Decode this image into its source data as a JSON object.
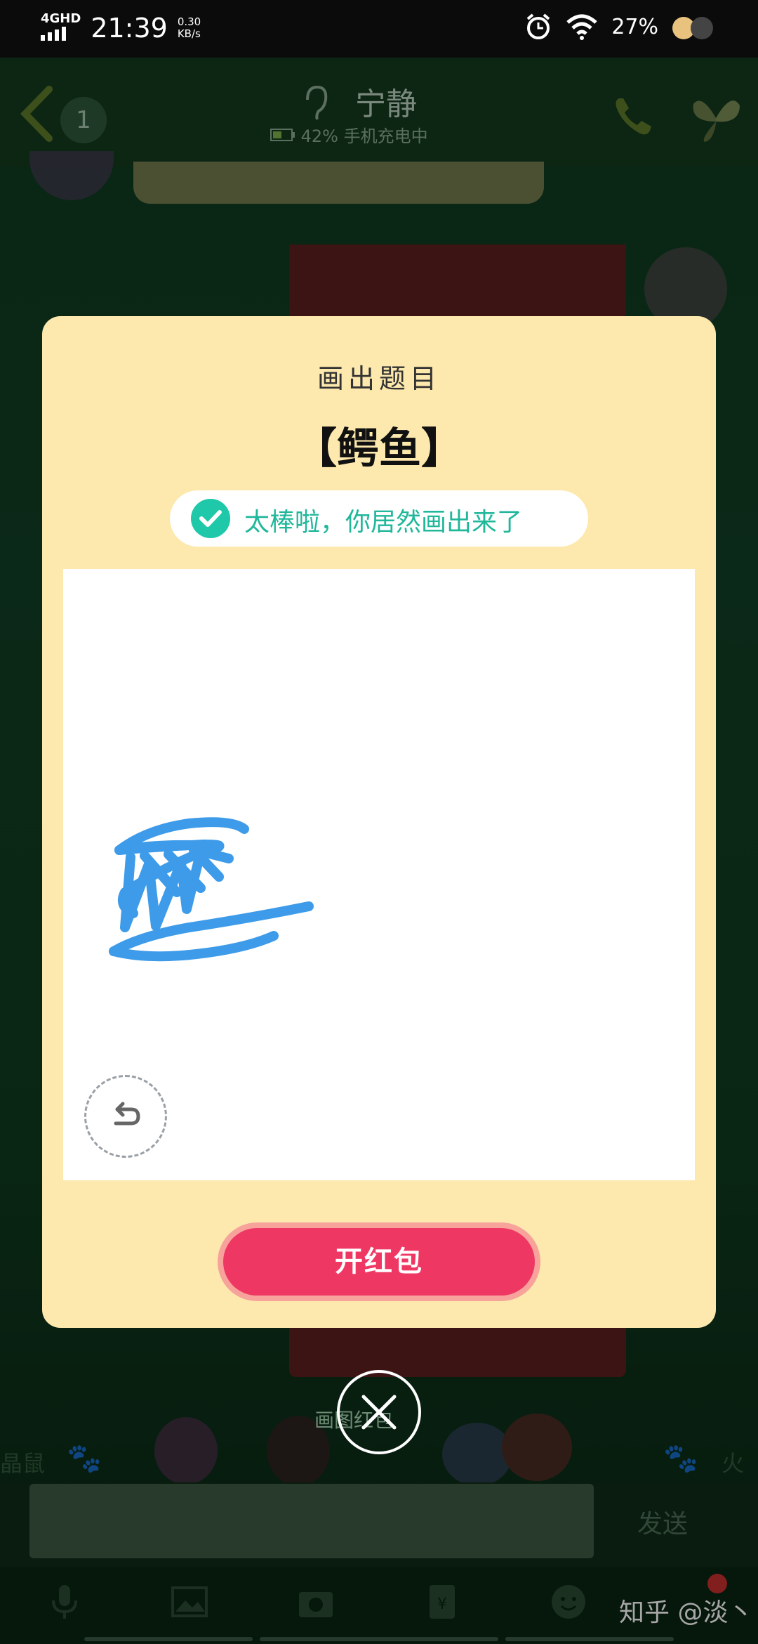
{
  "status_bar": {
    "network": "4GHD",
    "time": "21:39",
    "speed_value": "0.30",
    "speed_unit": "KB/s",
    "battery_percent": "27%"
  },
  "chat_header": {
    "unread_count": "1",
    "contact_name": "宁静",
    "battery_status": "42% 手机充电中"
  },
  "sticker_strip": {
    "left_label": "晶鼠",
    "right_label": "火为",
    "center_label": "画图红包"
  },
  "input_bar": {
    "send_label": "发送"
  },
  "modal": {
    "title": "画出题目",
    "word": "【鳄鱼】",
    "success_message": "太棒啦，你居然画出来了",
    "open_button_label": "开红包"
  },
  "watermark": "知乎 @淡丶",
  "colors": {
    "modal_bg": "#fde9ae",
    "success_green": "#1ec8a8",
    "button_red": "#ef3763",
    "stroke_blue": "#3d9be9"
  }
}
